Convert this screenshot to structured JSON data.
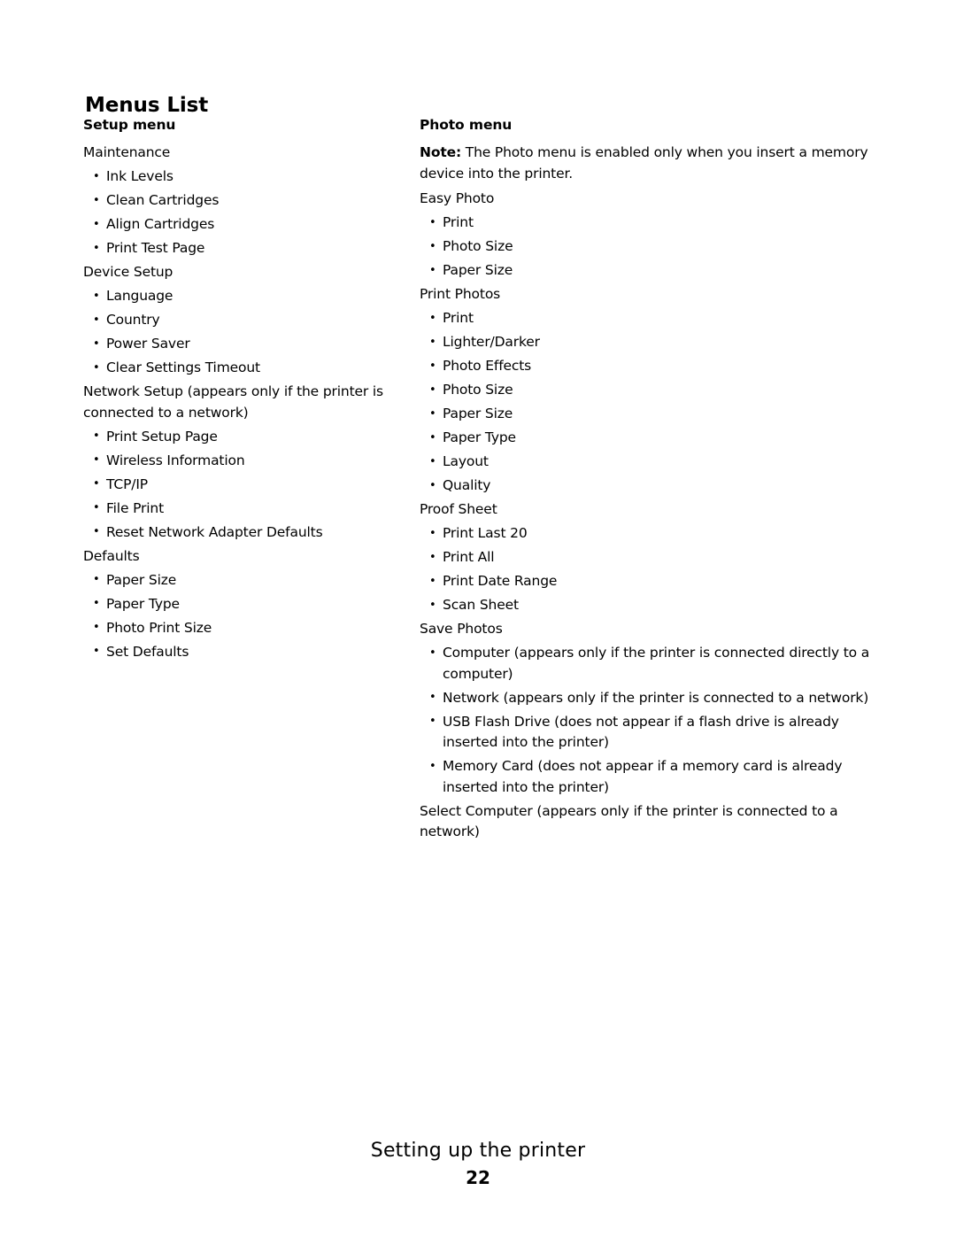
{
  "document": {
    "title": "Menus List",
    "footer_title": "Setting up the printer",
    "page_number": "22"
  },
  "left_column": {
    "heading": "Setup menu",
    "groups": [
      {
        "title": "Maintenance",
        "items": [
          "Ink Levels",
          "Clean Cartridges",
          "Align Cartridges",
          "Print Test Page"
        ]
      },
      {
        "title": "Device Setup",
        "items": [
          "Language",
          "Country",
          "Power Saver",
          "Clear Settings Timeout"
        ]
      },
      {
        "title": "Network Setup (appears only if the printer is connected to a network)",
        "items": [
          "Print Setup Page",
          "Wireless Information",
          "TCP/IP",
          "File Print",
          "Reset Network Adapter Defaults"
        ]
      },
      {
        "title": "Defaults",
        "items": [
          "Paper Size",
          "Paper Type",
          "Photo Print Size",
          "Set Defaults"
        ]
      }
    ]
  },
  "right_column": {
    "heading": "Photo menu",
    "note_label": "Note:",
    "note_text": " The Photo menu is enabled only when you insert a memory device into the printer.",
    "groups": [
      {
        "title": "Easy Photo",
        "items": [
          "Print",
          "Photo Size",
          "Paper Size"
        ]
      },
      {
        "title": "Print Photos",
        "items": [
          "Print",
          "Lighter/Darker",
          "Photo Effects",
          "Photo Size",
          "Paper Size",
          "Paper Type",
          "Layout",
          "Quality"
        ]
      },
      {
        "title": "Proof Sheet",
        "items": [
          "Print Last 20",
          "Print All",
          "Print Date Range",
          "Scan Sheet"
        ]
      },
      {
        "title": "Save Photos",
        "items": [
          "Computer (appears only if the printer is connected directly to a computer)",
          "Network (appears only if the printer is connected to a network)",
          "USB Flash Drive (does not appear if a flash drive is already inserted into the printer)",
          "Memory Card (does not appear if a memory card is already inserted into the printer)"
        ]
      },
      {
        "title": "Select Computer (appears only if the printer is connected to a network)",
        "items": []
      }
    ]
  }
}
